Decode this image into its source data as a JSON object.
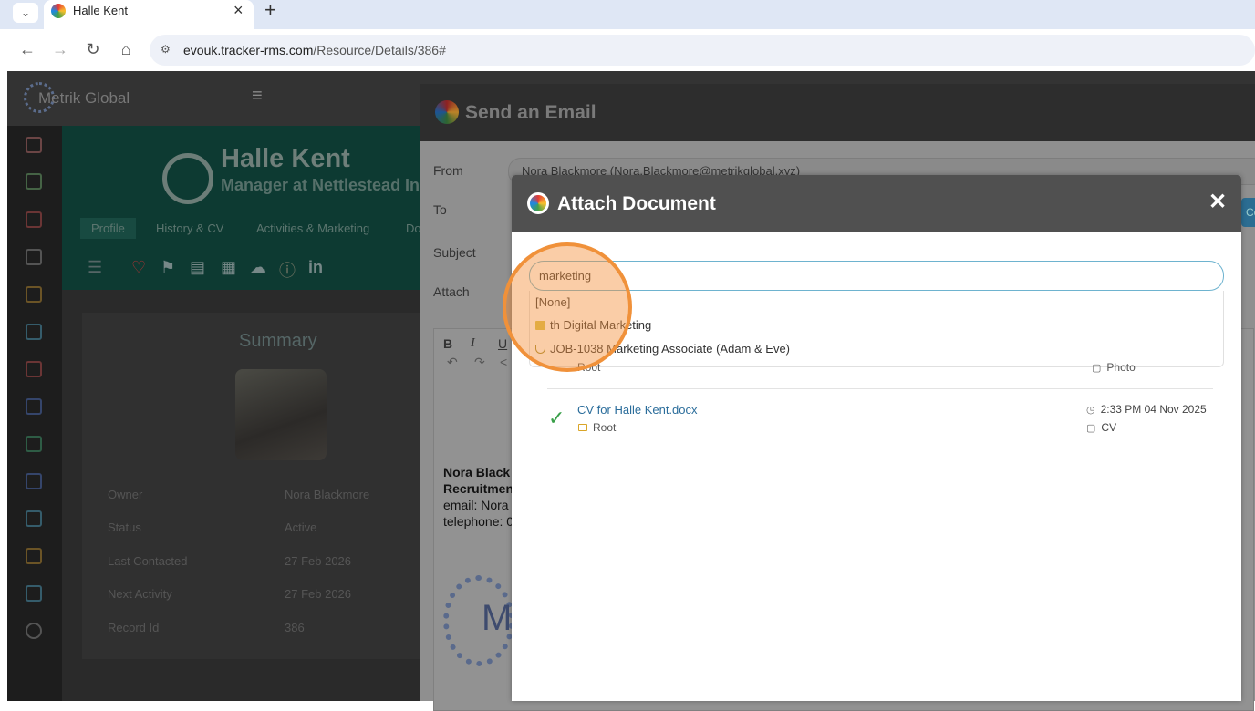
{
  "browser": {
    "tab_title": "Halle Kent",
    "url_host": "evouk.tracker-rms.com",
    "url_path": "/Resource/Details/386#"
  },
  "app": {
    "brand": "Metrik Global",
    "profile": {
      "name": "Halle Kent",
      "role": "Manager at Nettlestead In",
      "tabs": [
        "Profile",
        "History & CV",
        "Activities & Marketing",
        "Do"
      ]
    },
    "summary": {
      "title": "Summary",
      "rows": [
        {
          "label": "Owner",
          "value": "Nora Blackmore"
        },
        {
          "label": "Status",
          "value": "Active"
        },
        {
          "label": "Last Contacted",
          "value": "27 Feb 2026"
        },
        {
          "label": "Next Activity",
          "value": "27 Feb 2026"
        },
        {
          "label": "Record Id",
          "value": "386"
        }
      ]
    }
  },
  "email_modal": {
    "title": "Send an Email",
    "labels": {
      "from": "From",
      "to": "To",
      "subject": "Subject",
      "attach": "Attach"
    },
    "from_value": "Nora Blackmore (Nora.Blackmore@metrikglobal.xyz)",
    "signature": {
      "name": "Nora Black",
      "title": "Recruitmen",
      "email": "email: Nora",
      "phone": "telephone: 0"
    },
    "side_button": "Co"
  },
  "attach_modal": {
    "title": "Attach Document",
    "close": "✕",
    "search_value": "marketing",
    "dropdown": [
      {
        "label": "[None]"
      },
      {
        "label": "th Digital Marketing"
      },
      {
        "label": "JOB-1038 Marketing Associate (Adam & Eve)"
      }
    ],
    "photo_row": {
      "folder": "Root",
      "type": "Photo"
    },
    "document": {
      "name": "CV for Halle Kent.docx",
      "folder": "Root",
      "time": "2:33 PM 04 Nov 2025",
      "type": "CV"
    }
  },
  "colors": {
    "accent": "#2b6d9b",
    "highlight": "#f0913a",
    "check": "#3aa04a"
  }
}
